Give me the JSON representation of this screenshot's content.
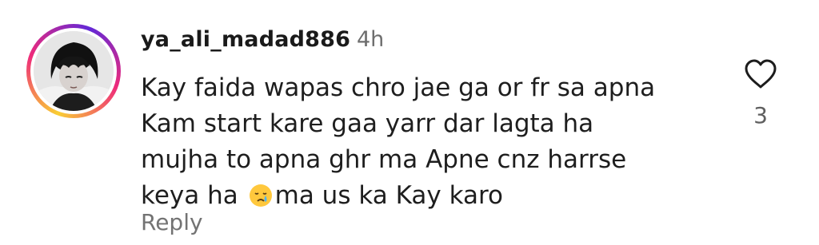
{
  "comment": {
    "username": "ya_ali_madad886",
    "timestamp": "4h",
    "text_lines": [
      "Kay faida wapas chro jae ga or fr sa apna",
      "Kam start kare gaa yarr dar lagta ha",
      "mujha to apna ghr ma Apne cnz harrse",
      "keya ha",
      "ma us ka Kay karo"
    ],
    "emoji": "crying-face",
    "reply_label": "Reply",
    "like_count": "3",
    "like_icon": "heart-outline-icon",
    "avatar_icon": "profile-avatar",
    "colors": {
      "story_ring_start": "#f9ce34",
      "story_ring_mid": "#ee2a7b",
      "story_ring_end": "#6228d7",
      "secondary_text": "#737373"
    }
  }
}
